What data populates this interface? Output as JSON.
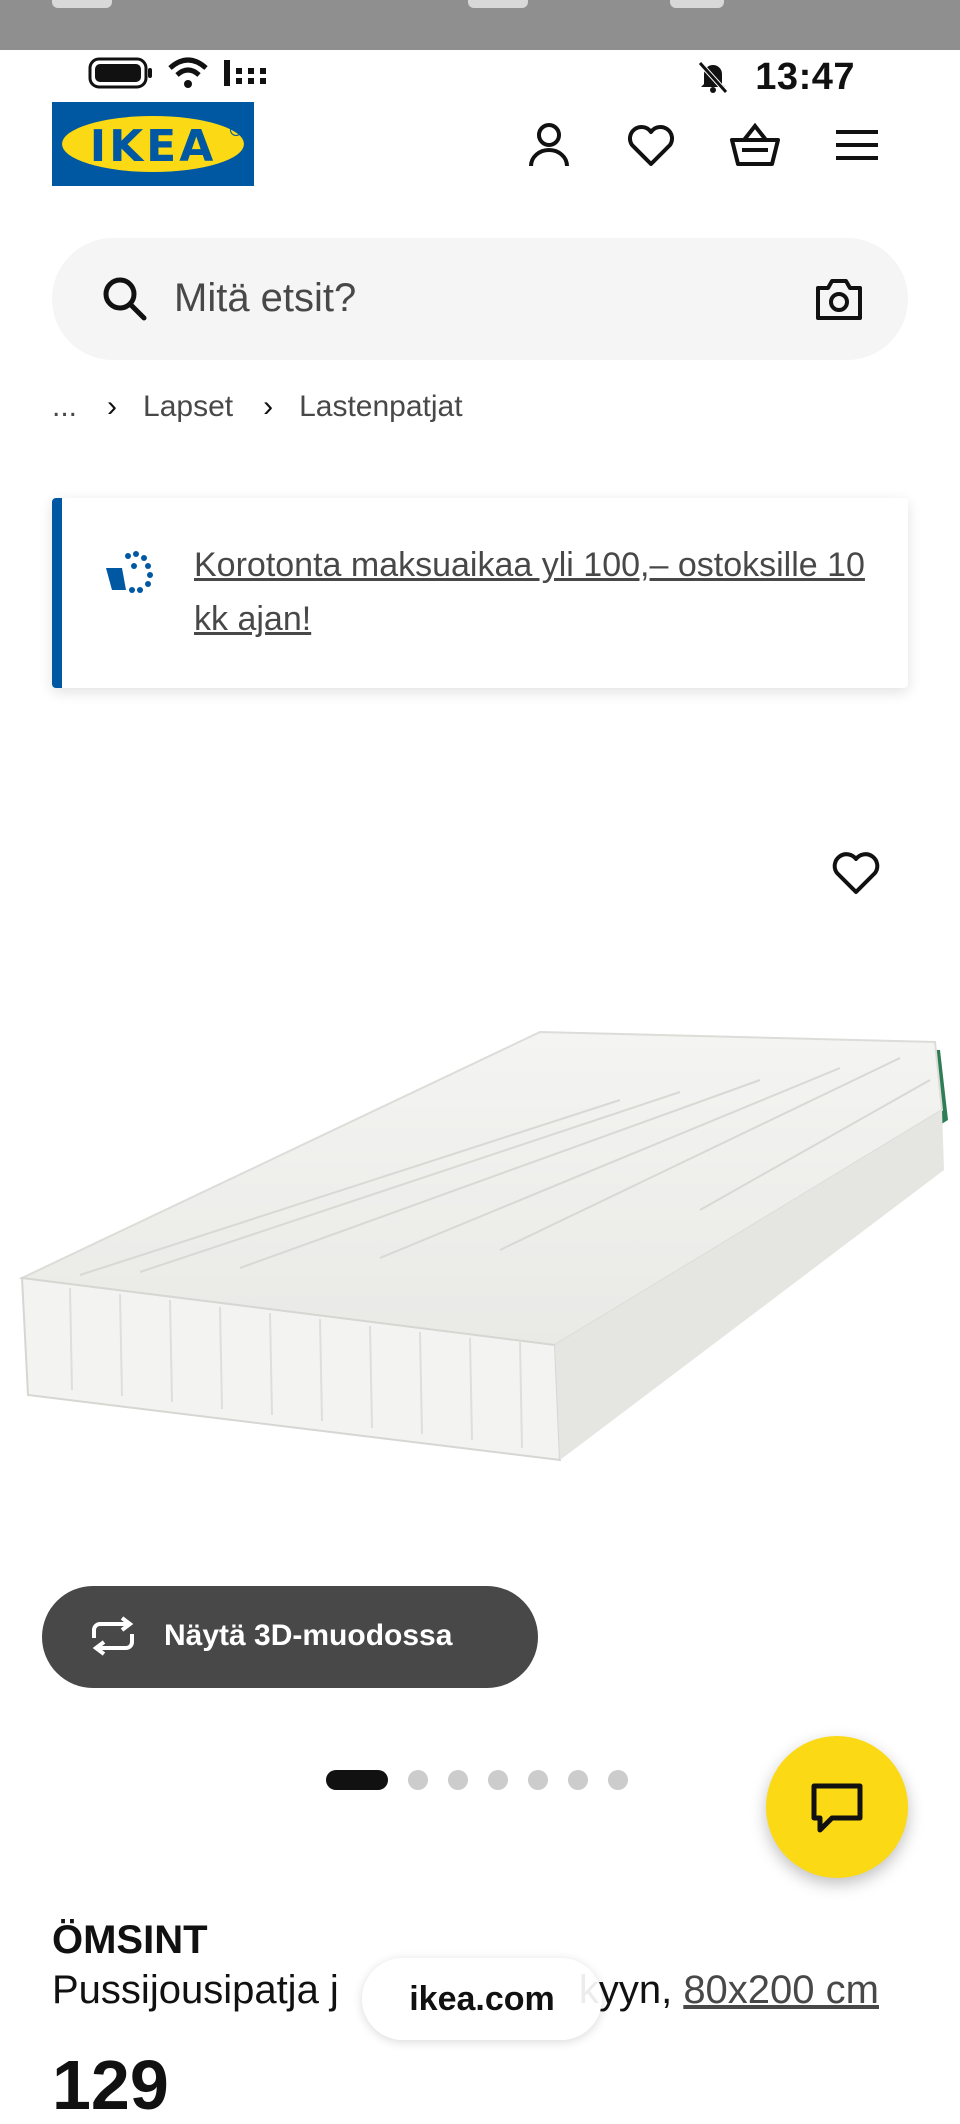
{
  "status_bar": {
    "time": "13:47"
  },
  "header": {
    "logo_text": "IKEA",
    "icons": [
      "user-icon",
      "heart-icon",
      "basket-icon",
      "menu-icon"
    ]
  },
  "search": {
    "placeholder": "Mitä etsit?"
  },
  "breadcrumb": {
    "ellipsis": "...",
    "items": [
      "Lapset",
      "Lastenpatjat"
    ]
  },
  "promo": {
    "text": "Korotonta maksuaikaa yli 100,– ostoksille 10 kk ajan!"
  },
  "gallery": {
    "button_3d": "Näytä 3D-muodossa",
    "dot_count": 7,
    "active_dot": 0
  },
  "product": {
    "name": "ÖMSINT",
    "desc_start": "Pussijousipatja j",
    "desc_end": "kyyn,",
    "size": "80x200 cm",
    "price_partial": "129"
  },
  "browser": {
    "url_pill": "ikea.com"
  },
  "colors": {
    "brand_blue": "#0058a3",
    "brand_yellow": "#fbd914",
    "dark_button": "#484848"
  }
}
